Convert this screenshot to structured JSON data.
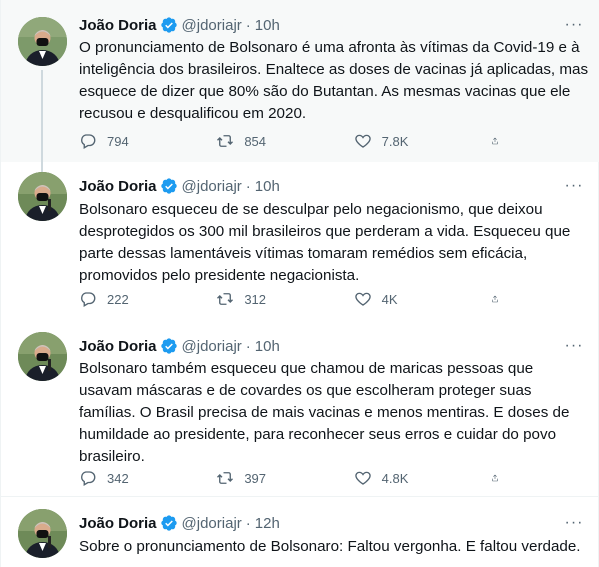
{
  "colors": {
    "verified": "#1d9bf0",
    "muted": "#536471",
    "highlight": "#f7f9f9",
    "thread_line": "#cfd9de"
  },
  "tweets": [
    {
      "name": "João Doria",
      "handle": "@jdoriajr",
      "dot": "·",
      "time": "10h",
      "text": "O pronunciamento de Bolsonaro é uma afronta às vítimas da Covid-19 e à inteligência dos brasileiros. Enaltece as doses de vacinas já aplicadas, mas esquece de dizer que 80% são do Butantan. As mesmas vacinas que ele recusou e desqualificou em 2020.",
      "replies": "794",
      "retweets": "854",
      "likes": "7.8K",
      "more_icon": "ellipsis-icon"
    },
    {
      "name": "João Doria",
      "handle": "@jdoriajr",
      "dot": "·",
      "time": "10h",
      "text": "Bolsonaro esqueceu de se desculpar pelo negacionismo, que deixou desprotegidos os 300 mil brasileiros que perderam a vida. Esqueceu que parte dessas lamentáveis vítimas tomaram remédios sem eficácia, promovidos pelo presidente negacionista.",
      "replies": "222",
      "retweets": "312",
      "likes": "4K",
      "more_icon": "ellipsis-icon"
    },
    {
      "name": "João Doria",
      "handle": "@jdoriajr",
      "dot": "·",
      "time": "10h",
      "text": "Bolsonaro também esqueceu que chamou de maricas pessoas que usavam máscaras e de covardes os que escolheram proteger suas famílias. O Brasil precisa de mais vacinas e menos mentiras. E doses de humildade ao presidente, para reconhecer seus erros e cuidar do povo brasileiro.",
      "replies": "342",
      "retweets": "397",
      "likes": "4.8K",
      "more_icon": "ellipsis-icon"
    },
    {
      "name": "João Doria",
      "handle": "@jdoriajr",
      "dot": "·",
      "time": "12h",
      "text": "Sobre o pronunciamento de Bolsonaro: Faltou vergonha. E faltou verdade.",
      "more_icon": "ellipsis-icon"
    }
  ]
}
